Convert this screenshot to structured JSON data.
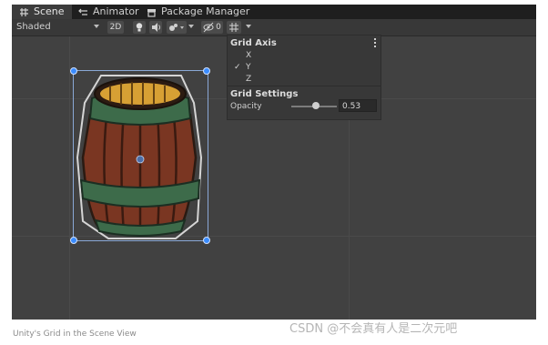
{
  "tabs": [
    {
      "label": "Scene",
      "icon": "grid-icon",
      "active": true
    },
    {
      "label": "Animator",
      "icon": "animator-icon"
    },
    {
      "label": "Package Manager",
      "icon": "package-icon"
    }
  ],
  "toolbar": {
    "shading_mode": "Shaded",
    "btn_2d": "2D",
    "hidden_count": "0",
    "icons": [
      "lightbulb-icon",
      "audio-icon",
      "effects-icon",
      "visibility-icon",
      "grid-toggle-icon"
    ]
  },
  "grid_panel": {
    "axis_title": "Grid Axis",
    "axes": [
      "X",
      "Y",
      "Z"
    ],
    "selected_axis": "Y",
    "check_mark": "✓",
    "settings_title": "Grid Settings",
    "opacity_label": "Opacity",
    "opacity_value": "0.53",
    "opacity_fraction": 0.53
  },
  "caption": "Unity's Grid in the Scene View",
  "watermark": "CSDN @不会真有人是二次元吧"
}
